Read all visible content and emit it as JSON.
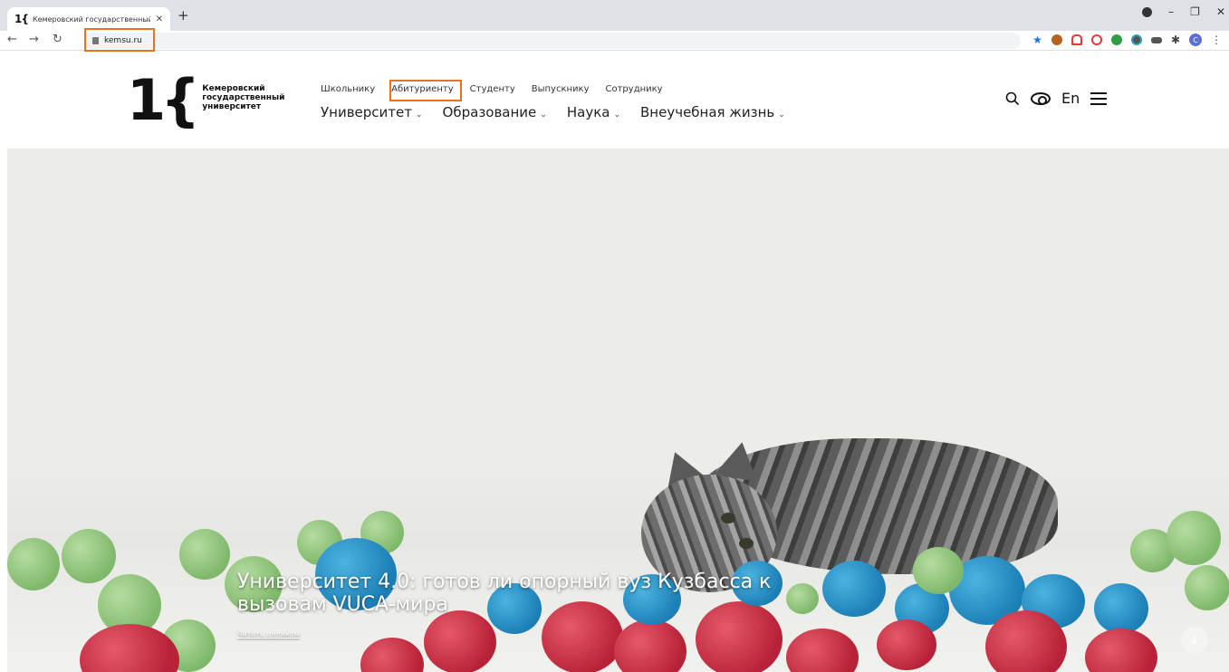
{
  "browser": {
    "tab_title": "Кемеровский государственный",
    "tab_favicon": "1{",
    "new_tab": "+",
    "url": "kemsu.ru",
    "avatar_letter": "C"
  },
  "site": {
    "logo_mark": "1{",
    "logo_lines": [
      "Кемеровский",
      "государственный",
      "университет"
    ],
    "top_nav": [
      "Школьнику",
      "Абитуриенту",
      "Студенту",
      "Выпускнику",
      "Сотруднику"
    ],
    "main_nav": [
      "Университет",
      "Образование",
      "Наука",
      "Внеучебная жизнь"
    ],
    "lang": "En"
  },
  "hero": {
    "title": "Университет 4.0: готов ли опорный вуз Кузбасса к вызовам VUCA-мира",
    "read_more": "Читать целиком"
  },
  "colors": {
    "highlight": "#e7731f",
    "chrome_bg": "#dee1e6"
  }
}
